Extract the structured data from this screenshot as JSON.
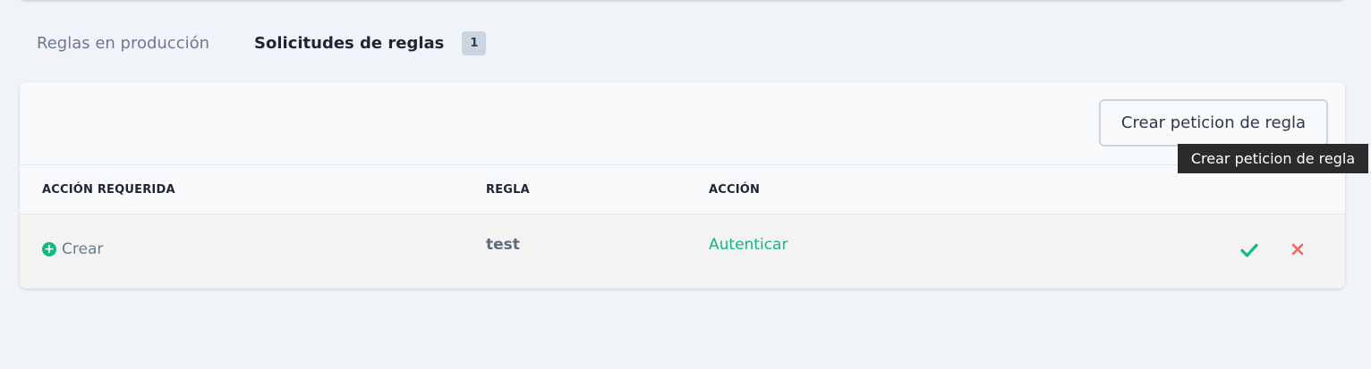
{
  "tabs": [
    {
      "label": "Reglas en producción",
      "active": false
    },
    {
      "label": "Solicitudes de reglas",
      "active": true,
      "badge": "1"
    }
  ],
  "toolbar": {
    "create_label": "Crear peticion de regla"
  },
  "tooltip": {
    "text": "Crear peticion de regla"
  },
  "table": {
    "columns": [
      "ACCIÓN REQUERIDA",
      "REGLA",
      "ACCIÓN"
    ],
    "rows": [
      {
        "action_required": "Crear",
        "action_required_icon": "plus-circle-icon",
        "rule": "test",
        "action": "Autenticar",
        "row_actions": [
          "check-icon",
          "x-icon"
        ]
      }
    ]
  },
  "colors": {
    "background": "#f0f4f8",
    "card": "#f8fafc",
    "accent_green": "#10b981",
    "reject_red": "#f56565",
    "badge_bg": "#cbd5e1",
    "tooltip_bg": "#2b2b2b"
  }
}
